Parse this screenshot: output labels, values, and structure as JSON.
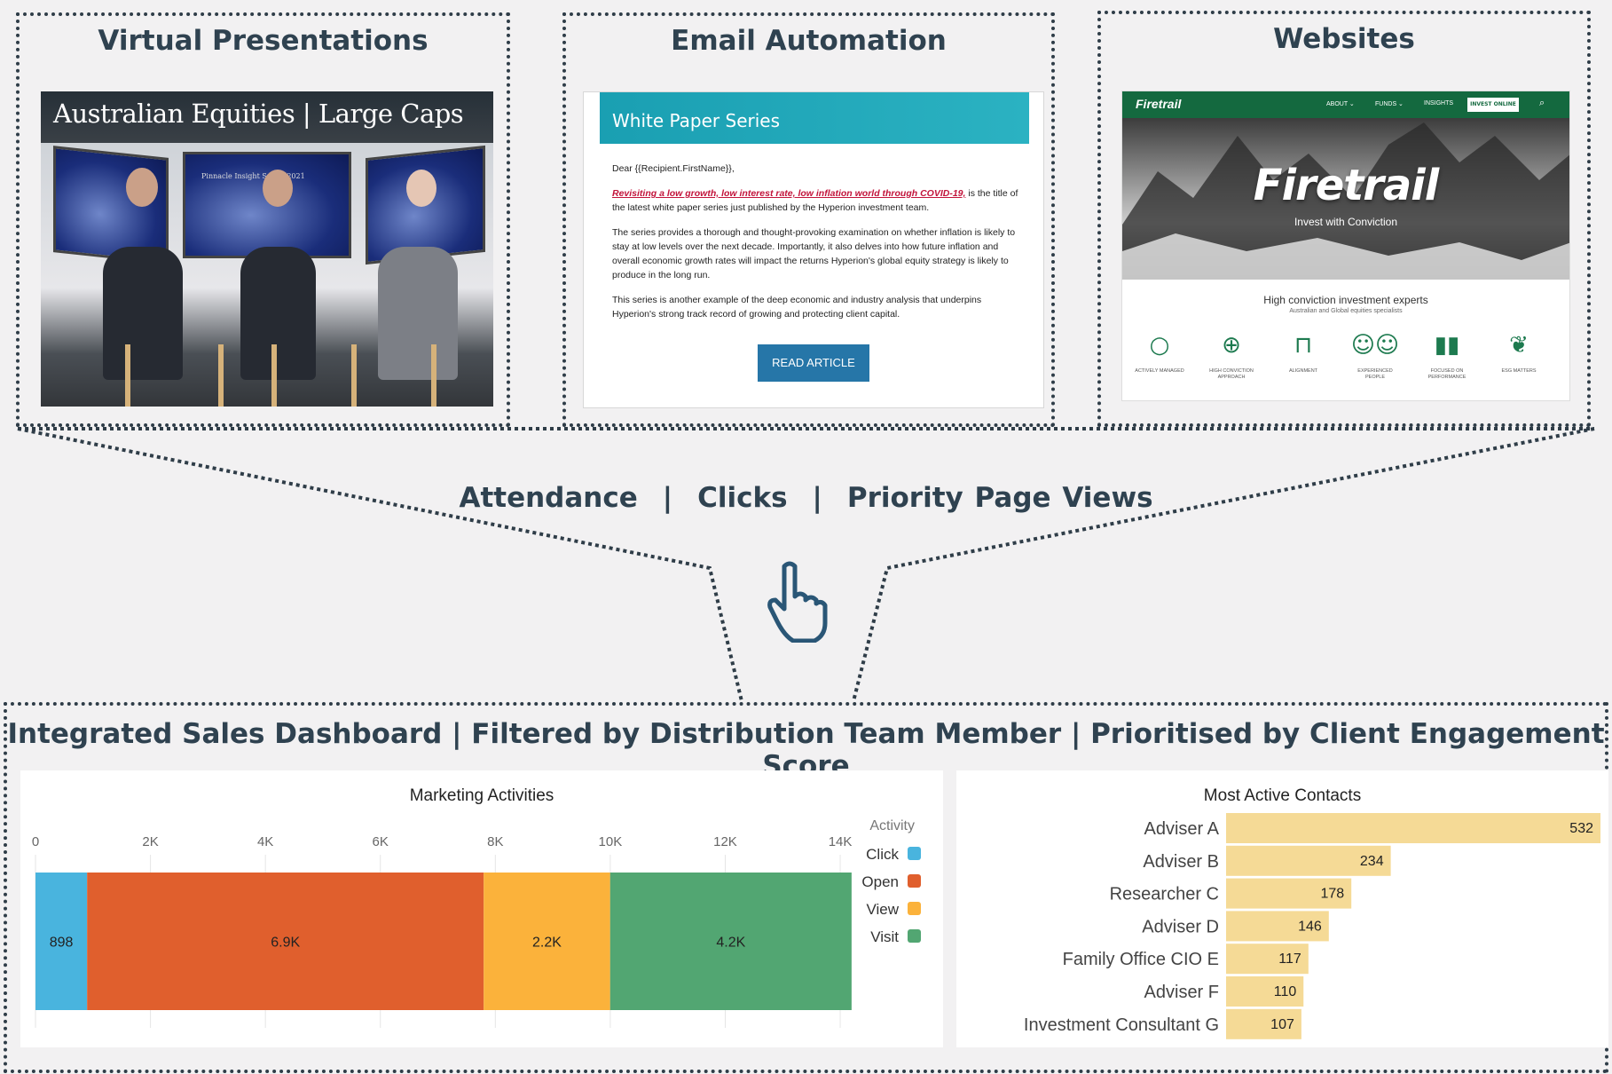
{
  "panels": {
    "virtual": {
      "title": "Virtual Presentations",
      "video_title": "Australian Equities | Large Caps",
      "screen_text": "Pinnacle Insight Series 2021"
    },
    "email": {
      "title": "Email Automation",
      "banner": "White Paper Series",
      "greeting": "Dear {{Recipient.FirstName}},",
      "link_text": "Revisiting a low growth, low interest rate, low inflation world through COVID-19,",
      "p1_rest": " is the title of the latest white paper series just published by the Hyperion investment team.",
      "p2": "The series provides a thorough and thought-provoking examination on whether inflation is likely to stay at low levels over the next decade. Importantly, it also delves into how future inflation and overall economic growth rates will impact the returns Hyperion's global equity strategy is likely to produce in the long run.",
      "p3": "This series is another example of the deep economic and industry analysis that underpins Hyperion's strong track record of growing and protecting client capital.",
      "button": "READ ARTICLE"
    },
    "website": {
      "title": "Websites",
      "logo": "Firetrail",
      "nav": [
        "ABOUT ⌄",
        "FUNDS ⌄",
        "INSIGHTS"
      ],
      "invest_button": "INVEST ONLINE",
      "brand": "Firetrail",
      "tagline": "Invest with Conviction",
      "headline": "High conviction investment experts",
      "subheadline": "Australian and Global equities specialists",
      "features": [
        {
          "label": "ACTIVELY MANAGED",
          "icon": "magnifier-icon"
        },
        {
          "label": "HIGH CONVICTION APPROACH",
          "icon": "crosshair-icon"
        },
        {
          "label": "ALIGNMENT",
          "icon": "desk-icon"
        },
        {
          "label": "EXPERIENCED PEOPLE",
          "icon": "people-icon"
        },
        {
          "label": "FOCUSED ON PERFORMANCE",
          "icon": "bar-icon"
        },
        {
          "label": "ESG MATTERS",
          "icon": "sprout-icon"
        }
      ]
    }
  },
  "metrics": {
    "a": "Attendance",
    "sep": "|",
    "b": "Clicks",
    "c": "Priority Page Views"
  },
  "dashboard": {
    "title": "Integrated Sales Dashboard | Filtered by Distribution Team Member | Prioritised by Client Engagement Score"
  },
  "chart_data": [
    {
      "type": "bar",
      "orientation": "horizontal-stacked",
      "title": "Marketing Activities",
      "x_ticks": [
        "0",
        "2K",
        "4K",
        "6K",
        "8K",
        "10K",
        "12K",
        "14K"
      ],
      "xlim": [
        0,
        14200
      ],
      "legend_title": "Activity",
      "legend_position": "right",
      "series": [
        {
          "name": "Click",
          "value": 898,
          "label": "898",
          "color": "#49b4de"
        },
        {
          "name": "Open",
          "value": 6900,
          "label": "6.9K",
          "color": "#e05f2d"
        },
        {
          "name": "View",
          "value": 2200,
          "label": "2.2K",
          "color": "#fbb23b"
        },
        {
          "name": "Visit",
          "value": 4200,
          "label": "4.2K",
          "color": "#52a672"
        }
      ]
    },
    {
      "type": "bar",
      "orientation": "horizontal",
      "title": "Most Active Contacts",
      "color": "#f5da96",
      "categories": [
        "Adviser A",
        "Adviser B",
        "Researcher C",
        "Adviser D",
        "Family Office CIO E",
        "Adviser F",
        "Investment Consultant G"
      ],
      "values": [
        532,
        234,
        178,
        146,
        117,
        110,
        107
      ]
    }
  ]
}
